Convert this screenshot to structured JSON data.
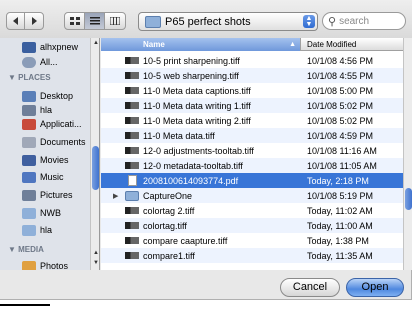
{
  "toolbar": {
    "back_icon": "back-arrow-icon",
    "forward_icon": "forward-arrow-icon",
    "view_modes": [
      "icon-view-icon",
      "list-view-icon",
      "column-view-icon"
    ],
    "active_view": "list-view-icon",
    "path_popup_label": "P65 perfect shots",
    "search_placeholder": "search"
  },
  "sidebar": {
    "items": [
      {
        "label": "alhxpnew",
        "icon": "disk-icon",
        "color": "#3a5f9f"
      },
      {
        "label": "All...",
        "icon": "network-icon",
        "color": "#8a9cb8"
      },
      {
        "label": "Desktop",
        "icon": "desktop-icon",
        "color": "#5a7fb8"
      },
      {
        "label": "hla",
        "icon": "home-icon",
        "color": "#6f7f99"
      },
      {
        "label": "Applicati...",
        "icon": "applications-icon",
        "color": "#c84a3a"
      },
      {
        "label": "Documents",
        "icon": "documents-icon",
        "color": "#a0a8b8"
      },
      {
        "label": "Movies",
        "icon": "movies-icon",
        "color": "#3f5f9f"
      },
      {
        "label": "Music",
        "icon": "music-icon",
        "color": "#4f76c0"
      },
      {
        "label": "Pictures",
        "icon": "pictures-icon",
        "color": "#6f7f99"
      },
      {
        "label": "NWB",
        "icon": "folder-icon",
        "color": "#8fb0d9"
      },
      {
        "label": "hla",
        "icon": "folder-icon",
        "color": "#8fb0d9"
      },
      {
        "label": "Photos",
        "icon": "photos-icon",
        "color": "#e0a040"
      }
    ],
    "headers": {
      "places": "▼ PLACES",
      "media": "▼ MEDIA"
    }
  },
  "list": {
    "columns": {
      "name": "Name",
      "date": "Date Modified"
    },
    "rows": [
      {
        "name": "10-5 print sharpening.tiff",
        "date": "10/1/08 4:56 PM",
        "icon": "tiff-icon"
      },
      {
        "name": "10-5 web sharpening.tiff",
        "date": "10/1/08 4:55 PM",
        "icon": "tiff-icon"
      },
      {
        "name": "11-0 Meta data captions.tiff",
        "date": "10/1/08 5:00 PM",
        "icon": "tiff-icon"
      },
      {
        "name": "11-0 Meta data writing 1.tiff",
        "date": "10/1/08 5:02 PM",
        "icon": "tiff-icon"
      },
      {
        "name": "11-0 Meta data writing 2.tiff",
        "date": "10/1/08 5:02 PM",
        "icon": "tiff-icon"
      },
      {
        "name": "11-0 Meta data.tiff",
        "date": "10/1/08 4:59 PM",
        "icon": "tiff-icon"
      },
      {
        "name": "12-0 adjustments-tooltab.tiff",
        "date": "10/1/08 11:16 AM",
        "icon": "tiff-icon"
      },
      {
        "name": "12-0 metadata-tooltab.tiff",
        "date": "10/1/08 11:05 AM",
        "icon": "tiff-icon"
      },
      {
        "name": "2008100614093774.pdf",
        "date": "Today, 2:18 PM",
        "icon": "pdf-icon"
      },
      {
        "name": "CaptureOne",
        "date": "10/1/08 5:19 PM",
        "icon": "folder-icon"
      },
      {
        "name": "colortag 2.tiff",
        "date": "Today, 11:02 AM",
        "icon": "tiff-icon"
      },
      {
        "name": "colortag.tiff",
        "date": "Today, 11:00 AM",
        "icon": "tiff-icon"
      },
      {
        "name": "compare caapture.tiff",
        "date": "Today, 1:38 PM",
        "icon": "tiff-icon"
      },
      {
        "name": "compare1.tiff",
        "date": "Today, 11:35 AM",
        "icon": "tiff-icon"
      }
    ],
    "selected_index": 8
  },
  "buttons": {
    "cancel": "Cancel",
    "open": "Open"
  }
}
